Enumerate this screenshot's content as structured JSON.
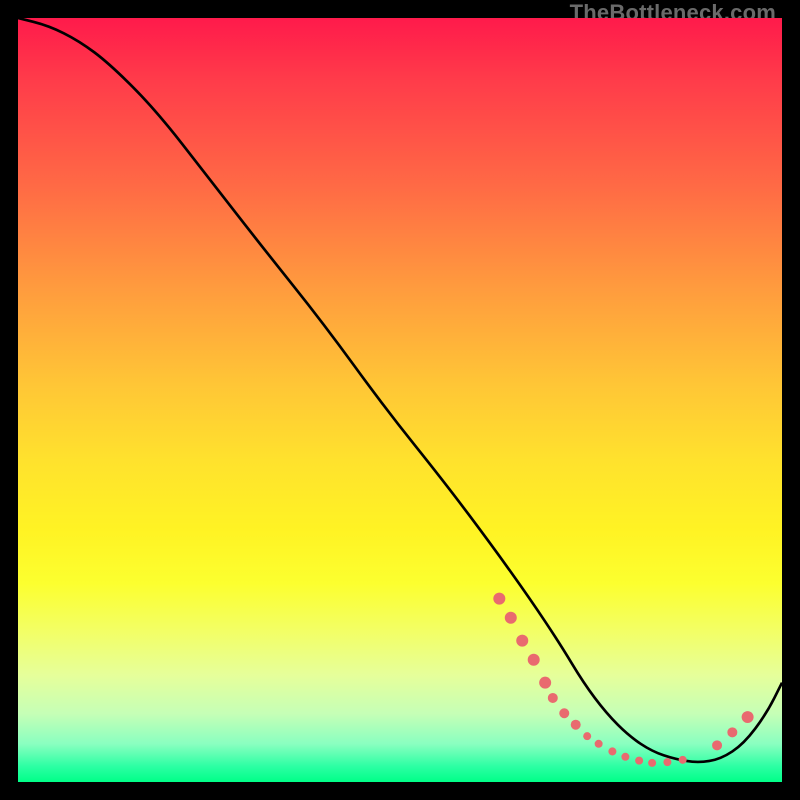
{
  "attribution": "TheBottleneck.com",
  "chart_data": {
    "type": "line",
    "title": "",
    "xlabel": "",
    "ylabel": "",
    "xlim": [
      0,
      100
    ],
    "ylim": [
      0,
      100
    ],
    "series": [
      {
        "name": "curve",
        "x": [
          0,
          4,
          8,
          12,
          18,
          25,
          32,
          40,
          48,
          56,
          62,
          67,
          71,
          74,
          77,
          80,
          83,
          86,
          89,
          92,
          95,
          98,
          100
        ],
        "y": [
          100,
          99,
          97,
          94,
          88,
          79,
          70,
          60,
          49,
          39,
          31,
          24,
          18,
          13,
          9,
          6,
          4,
          3,
          2.5,
          3,
          5,
          9,
          13
        ]
      }
    ],
    "markers": [
      {
        "x": 63.0,
        "y": 24.0,
        "r": 6
      },
      {
        "x": 64.5,
        "y": 21.5,
        "r": 6
      },
      {
        "x": 66.0,
        "y": 18.5,
        "r": 6
      },
      {
        "x": 67.5,
        "y": 16.0,
        "r": 6
      },
      {
        "x": 69.0,
        "y": 13.0,
        "r": 6
      },
      {
        "x": 70.0,
        "y": 11.0,
        "r": 5
      },
      {
        "x": 71.5,
        "y": 9.0,
        "r": 5
      },
      {
        "x": 73.0,
        "y": 7.5,
        "r": 5
      },
      {
        "x": 74.5,
        "y": 6.0,
        "r": 4
      },
      {
        "x": 76.0,
        "y": 5.0,
        "r": 4
      },
      {
        "x": 77.8,
        "y": 4.0,
        "r": 4
      },
      {
        "x": 79.5,
        "y": 3.3,
        "r": 4
      },
      {
        "x": 81.3,
        "y": 2.8,
        "r": 4
      },
      {
        "x": 83.0,
        "y": 2.5,
        "r": 4
      },
      {
        "x": 85.0,
        "y": 2.6,
        "r": 4
      },
      {
        "x": 87.0,
        "y": 2.9,
        "r": 4
      },
      {
        "x": 91.5,
        "y": 4.8,
        "r": 5
      },
      {
        "x": 93.5,
        "y": 6.5,
        "r": 5
      },
      {
        "x": 95.5,
        "y": 8.5,
        "r": 6
      }
    ],
    "marker_color": "#e96a6f",
    "curve_color": "#000000"
  }
}
